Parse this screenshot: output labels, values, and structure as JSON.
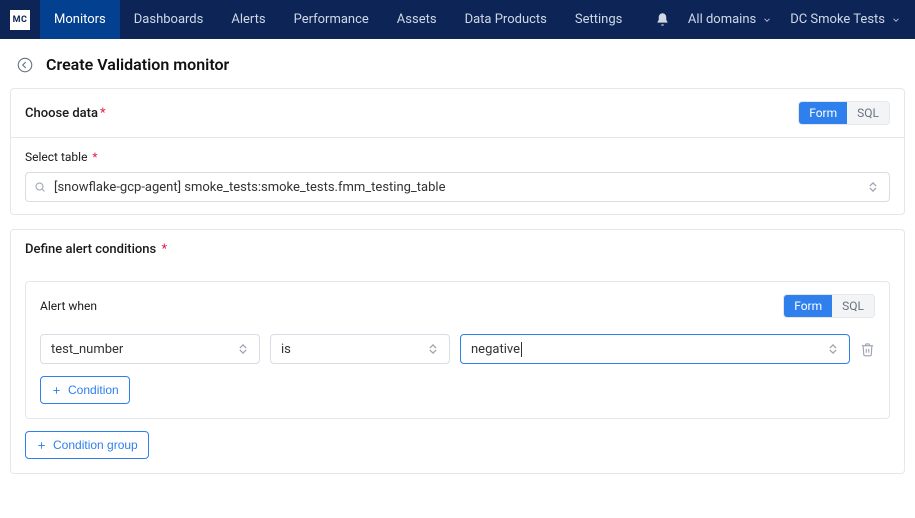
{
  "logo_text": "MC",
  "nav": {
    "items": [
      "Monitors",
      "Dashboards",
      "Alerts",
      "Performance",
      "Assets",
      "Data Products",
      "Settings"
    ],
    "active_index": 0,
    "domain_label": "All domains",
    "account_label": "DC Smoke Tests"
  },
  "page": {
    "title": "Create Validation monitor"
  },
  "choose_data": {
    "section_title": "Choose data",
    "toggle_form": "Form",
    "toggle_sql": "SQL",
    "field_label": "Select table",
    "selected_table": "[snowflake-gcp-agent] smoke_tests:smoke_tests.fmm_testing_table"
  },
  "alert_conditions": {
    "section_title": "Define alert conditions",
    "alert_when_label": "Alert when",
    "toggle_form": "Form",
    "toggle_sql": "SQL",
    "field_select": "test_number",
    "operator_select": "is",
    "value_select": "negative",
    "add_condition_label": "Condition",
    "add_group_label": "Condition group"
  }
}
